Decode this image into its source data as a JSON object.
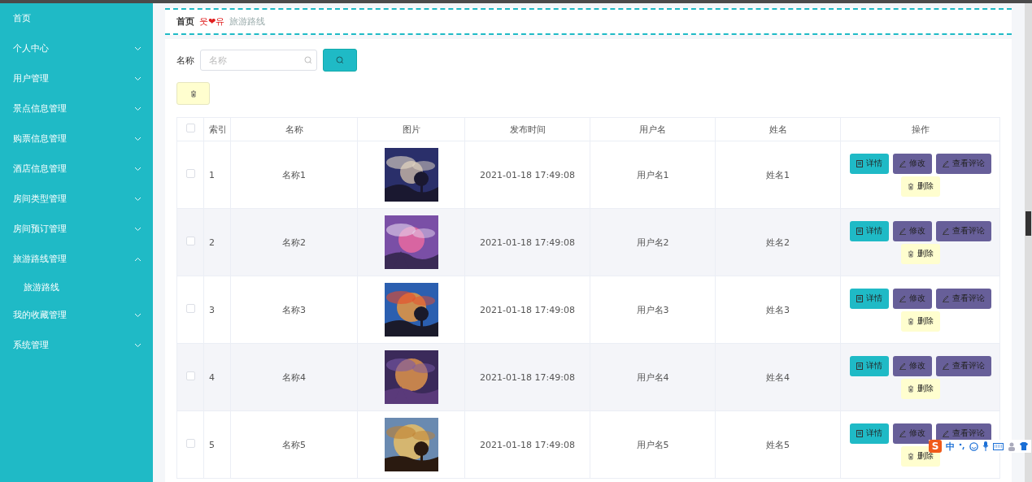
{
  "sidebar": {
    "items": [
      {
        "label": "首页",
        "expandable": false
      },
      {
        "label": "个人中心",
        "expandable": true,
        "expanded": false
      },
      {
        "label": "用户管理",
        "expandable": true,
        "expanded": false
      },
      {
        "label": "景点信息管理",
        "expandable": true,
        "expanded": false
      },
      {
        "label": "购票信息管理",
        "expandable": true,
        "expanded": false
      },
      {
        "label": "酒店信息管理",
        "expandable": true,
        "expanded": false
      },
      {
        "label": "房间类型管理",
        "expandable": true,
        "expanded": false
      },
      {
        "label": "房间预订管理",
        "expandable": true,
        "expanded": false
      },
      {
        "label": "旅游路线管理",
        "expandable": true,
        "expanded": true,
        "children": [
          {
            "label": "旅游路线"
          }
        ]
      },
      {
        "label": "我的收藏管理",
        "expandable": true,
        "expanded": false
      },
      {
        "label": "系统管理",
        "expandable": true,
        "expanded": false
      }
    ]
  },
  "breadcrumb": {
    "home": "首页",
    "separator": "웃❤유",
    "current": "旅游路线"
  },
  "search": {
    "label": "名称",
    "placeholder": "名称"
  },
  "table": {
    "all_checked": false,
    "columns": [
      "索引",
      "名称",
      "图片",
      "发布时间",
      "用户名",
      "姓名",
      "操作"
    ],
    "rows": [
      {
        "checked": false,
        "index": "1",
        "name": "名称1",
        "time": "2021-01-18 17:49:08",
        "username": "用户名1",
        "realname": "姓名1",
        "actions": [
          {
            "kind": "detail",
            "label": "详情"
          },
          {
            "kind": "edit",
            "label": "修改"
          },
          {
            "kind": "edit",
            "label": "查看评论"
          },
          {
            "kind": "delete",
            "label": "删除"
          }
        ]
      },
      {
        "checked": false,
        "index": "2",
        "name": "名称2",
        "time": "2021-01-18 17:49:08",
        "username": "用户名2",
        "realname": "姓名2",
        "actions": [
          {
            "kind": "detail",
            "label": "详情"
          },
          {
            "kind": "edit",
            "label": "修改"
          },
          {
            "kind": "edit",
            "label": "查看评论"
          },
          {
            "kind": "delete",
            "label": "删除"
          }
        ]
      },
      {
        "checked": false,
        "index": "3",
        "name": "名称3",
        "time": "2021-01-18 17:49:08",
        "username": "用户名3",
        "realname": "姓名3",
        "actions": [
          {
            "kind": "detail",
            "label": "详情"
          },
          {
            "kind": "edit",
            "label": "修改"
          },
          {
            "kind": "edit",
            "label": "查看评论"
          },
          {
            "kind": "delete",
            "label": "删除"
          }
        ]
      },
      {
        "checked": false,
        "index": "4",
        "name": "名称4",
        "time": "2021-01-18 17:49:08",
        "username": "用户名4",
        "realname": "姓名4",
        "actions": [
          {
            "kind": "detail",
            "label": "详情"
          },
          {
            "kind": "edit",
            "label": "修改"
          },
          {
            "kind": "edit",
            "label": "查看评论"
          },
          {
            "kind": "delete",
            "label": "删除"
          }
        ]
      },
      {
        "checked": false,
        "index": "5",
        "name": "名称5",
        "time": "2021-01-18 17:49:08",
        "username": "用户名5",
        "realname": "姓名5",
        "actions": [
          {
            "kind": "detail",
            "label": "详情"
          },
          {
            "kind": "edit",
            "label": "修改"
          },
          {
            "kind": "edit",
            "label": "查看评论"
          },
          {
            "kind": "delete",
            "label": "删除"
          }
        ]
      }
    ]
  },
  "ime_bar": {
    "logo": "S",
    "mode": "中"
  }
}
